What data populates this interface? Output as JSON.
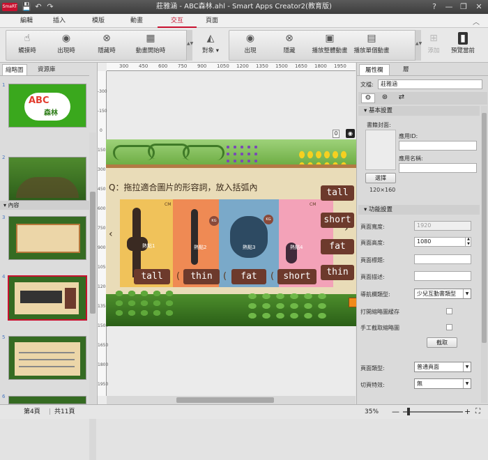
{
  "window": {
    "title": "莊雅涵 - ABC森林.ahl - Smart Apps Creator2(教育版)",
    "logo_text": "SmaRT"
  },
  "menu": {
    "items": [
      "編輯",
      "插入",
      "模版",
      "動畫",
      "交互",
      "頁面"
    ],
    "active": "交互"
  },
  "toolbar": {
    "group1": [
      "觸摸時",
      "出現時",
      "隱藏時",
      "動畫開始時"
    ],
    "object_label": "對象",
    "group2": [
      "出現",
      "隱藏",
      "播放整體動畫",
      "播放單個動畫"
    ],
    "add_label": "添加",
    "preview_label": "預覽當前"
  },
  "left_panel": {
    "tabs": [
      "縮略圖",
      "資源庫"
    ],
    "section_label": "內容",
    "page_numbers": [
      "1",
      "2",
      "3",
      "4",
      "5",
      "6"
    ],
    "thumb1_title": "森林",
    "thumb1_letters": "ABC"
  },
  "ruler": {
    "h": [
      "300",
      "450",
      "600",
      "750",
      "900",
      "1050",
      "1200",
      "1350",
      "1500",
      "1650",
      "1800",
      "1950"
    ],
    "v": [
      "-300",
      "-150",
      "0",
      "150",
      "300",
      "450",
      "600",
      "750",
      "900",
      "1050",
      "1200",
      "1350",
      "1500",
      "1650",
      "1800",
      "1950"
    ]
  },
  "slide": {
    "question": "Q：拖拉適合圖片的形容詞，放入括弧內",
    "answer_words": [
      "tall",
      "thin",
      "fat",
      "short"
    ],
    "bank_words": [
      "tall",
      "short",
      "fat",
      "thin"
    ],
    "image_labels": [
      "熱點1",
      "熱點2",
      "熱點3",
      "熱點4"
    ],
    "cm": "CM",
    "kg": "KG",
    "counter": "0",
    "bracket": "(",
    "nav_left": "‹",
    "nav_right": "›"
  },
  "right_panel": {
    "tabs": [
      "屬性欄",
      "層"
    ],
    "doc_label": "文檔:",
    "doc_value": "莊雅涵",
    "section_basic": "基本設置",
    "cover_label": "書籍封面:",
    "app_id_label": "應用ID:",
    "app_name_label": "應用名稱:",
    "select_button": "選擇",
    "cover_size": "120×160",
    "section_func": "功能設置",
    "page_width_label": "頁面寬度:",
    "page_width": "1920",
    "page_height_label": "頁面高度:",
    "page_height": "1080",
    "page_title_label": "頁面標題:",
    "page_desc_label": "頁面描述:",
    "nav_type_label": "導航欄類型:",
    "nav_type": "少兒互動書類型",
    "open_thumb_label": "打開縮略圖緩存",
    "manual_thumb_label": "手工截取縮略圖",
    "capture_button": "截取",
    "page_type_label": "頁面類型:",
    "page_type": "普通頁面",
    "transition_label": "切頁特效:",
    "transition": "無"
  },
  "status": {
    "page": "第4頁",
    "total": "共11頁",
    "zoom": "35%"
  },
  "colors": {
    "accent": "#c8102e",
    "word_box": "#6d3a2c",
    "board": "#e9dcb8"
  }
}
